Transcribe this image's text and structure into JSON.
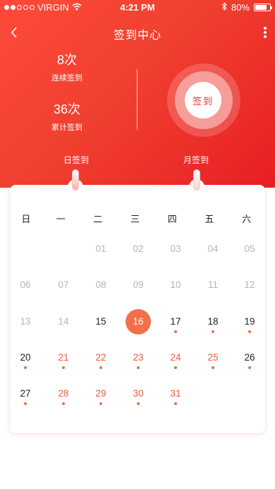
{
  "status_bar": {
    "carrier": "VIRGIN",
    "time": "4:21 PM",
    "battery": "80%",
    "battery_level": 0.8,
    "signal_bars_filled": 2,
    "signal_bars_total": 5
  },
  "nav": {
    "title": "签到中心"
  },
  "stats": {
    "consecutive_value": "8次",
    "consecutive_label": "连续签到",
    "total_value": "36次",
    "total_label": "累计签到"
  },
  "sign_button": "签到",
  "tabs": {
    "day": "日签到",
    "month": "月签到"
  },
  "calendar": {
    "weekdays": [
      "日",
      "一",
      "二",
      "三",
      "四",
      "五",
      "六"
    ],
    "weeks": [
      [
        null,
        null,
        {
          "d": "01",
          "s": "gray"
        },
        {
          "d": "02",
          "s": "gray"
        },
        {
          "d": "03",
          "s": "gray"
        },
        {
          "d": "04",
          "s": "gray"
        },
        {
          "d": "05",
          "s": "gray"
        }
      ],
      [
        {
          "d": "06",
          "s": "gray"
        },
        {
          "d": "07",
          "s": "gray"
        },
        {
          "d": "08",
          "s": "gray"
        },
        {
          "d": "09",
          "s": "gray"
        },
        {
          "d": "10",
          "s": "gray"
        },
        {
          "d": "11",
          "s": "gray"
        },
        {
          "d": "12",
          "s": "gray"
        }
      ],
      [
        {
          "d": "13",
          "s": "gray"
        },
        {
          "d": "14",
          "s": "gray"
        },
        {
          "d": "15",
          "s": "black"
        },
        {
          "d": "16",
          "s": "today"
        },
        {
          "d": "17",
          "s": "black",
          "dot": true
        },
        {
          "d": "18",
          "s": "black",
          "dot": true
        },
        {
          "d": "19",
          "s": "black",
          "dot": true
        }
      ],
      [
        {
          "d": "20",
          "s": "black",
          "dot": true
        },
        {
          "d": "21",
          "s": "orange",
          "dot": true
        },
        {
          "d": "22",
          "s": "orange",
          "dot": true
        },
        {
          "d": "23",
          "s": "orange",
          "dot": true
        },
        {
          "d": "24",
          "s": "orange",
          "dot": true
        },
        {
          "d": "25",
          "s": "orange",
          "dot": true
        },
        {
          "d": "26",
          "s": "black",
          "dot": true
        }
      ],
      [
        {
          "d": "27",
          "s": "black",
          "dot": true
        },
        {
          "d": "28",
          "s": "orange",
          "dot": true
        },
        {
          "d": "29",
          "s": "orange",
          "dot": true
        },
        {
          "d": "30",
          "s": "orange",
          "dot": true
        },
        {
          "d": "31",
          "s": "orange",
          "dot": true
        },
        null,
        null
      ]
    ]
  },
  "colors": {
    "header_start": "#ff4a3a",
    "header_end": "#e81e24",
    "accent": "#f1704c",
    "orange_text": "#ef5b3a",
    "gray_text": "#b5b5b5"
  },
  "icons": [
    "back-icon",
    "more-icon",
    "wifi-icon",
    "bluetooth-icon",
    "battery-icon"
  ]
}
